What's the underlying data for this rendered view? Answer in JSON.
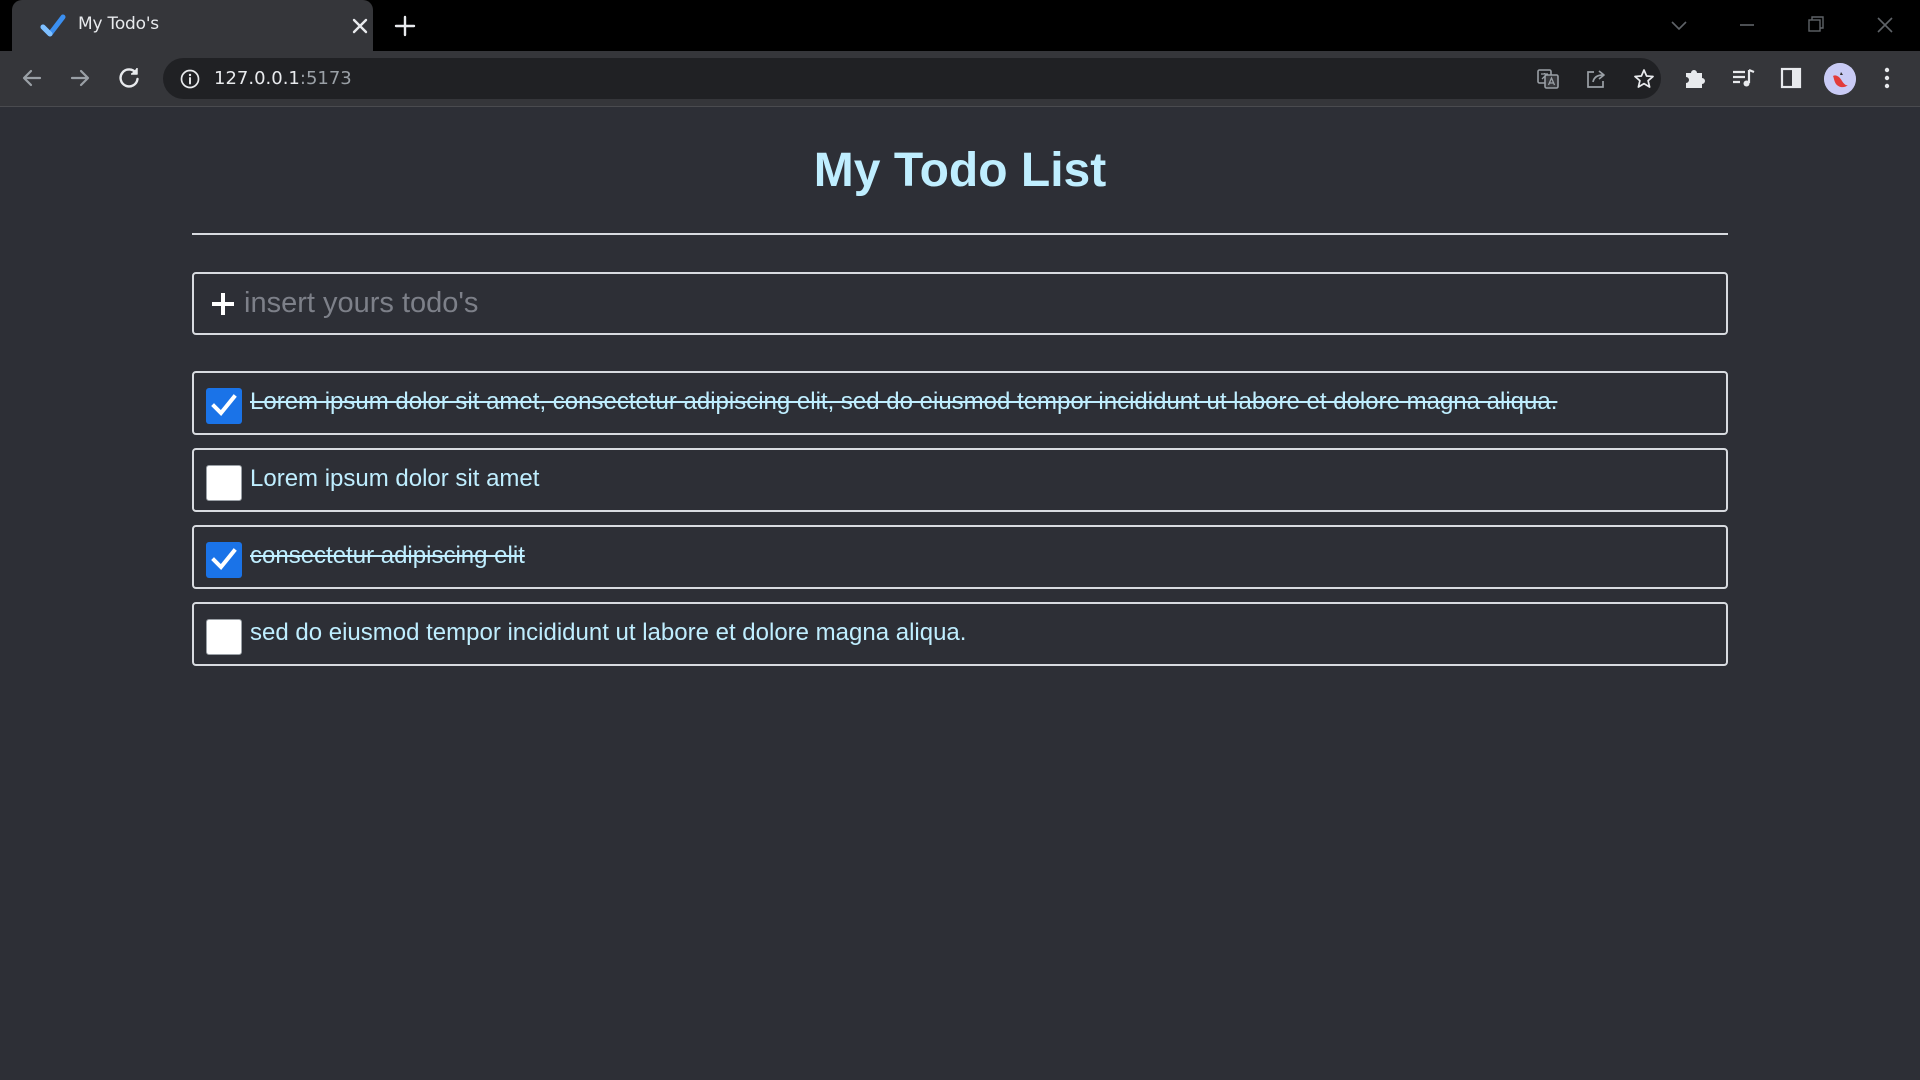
{
  "browser": {
    "tab_title": "My Todo's",
    "url_host": "127.0.0.1",
    "url_port": ":5173"
  },
  "page": {
    "title": "My Todo List",
    "add_placeholder": "insert yours todo's"
  },
  "todos": [
    {
      "text": "Lorem ipsum dolor sit amet, consectetur adipiscing elit, sed do eiusmod tempor incididunt ut labore et dolore magna aliqua.",
      "done": true
    },
    {
      "text": "Lorem ipsum dolor sit amet",
      "done": false
    },
    {
      "text": "consectetur adipiscing elit",
      "done": true
    },
    {
      "text": "sed do eiusmod tempor incididunt ut labore et dolore magna aliqua.",
      "done": false
    }
  ],
  "colors": {
    "page_background": "#2d2f36",
    "title": "#bfeeff",
    "border": "#d8dbe0",
    "checkbox_checked": "#1a73e8"
  },
  "icons": {
    "tab_favicon": "checkmark-icon",
    "tab_close": "close-icon",
    "new_tab": "plus-icon",
    "back": "back-arrow-icon",
    "forward": "forward-arrow-icon",
    "reload": "reload-icon",
    "site_info": "info-icon",
    "translate": "translate-icon",
    "share": "share-icon",
    "bookmark": "star-icon",
    "extensions": "puzzle-icon",
    "media": "media-queue-icon",
    "side_panel": "side-panel-icon",
    "menu": "kebab-menu-icon",
    "add_todo": "plus-icon"
  }
}
